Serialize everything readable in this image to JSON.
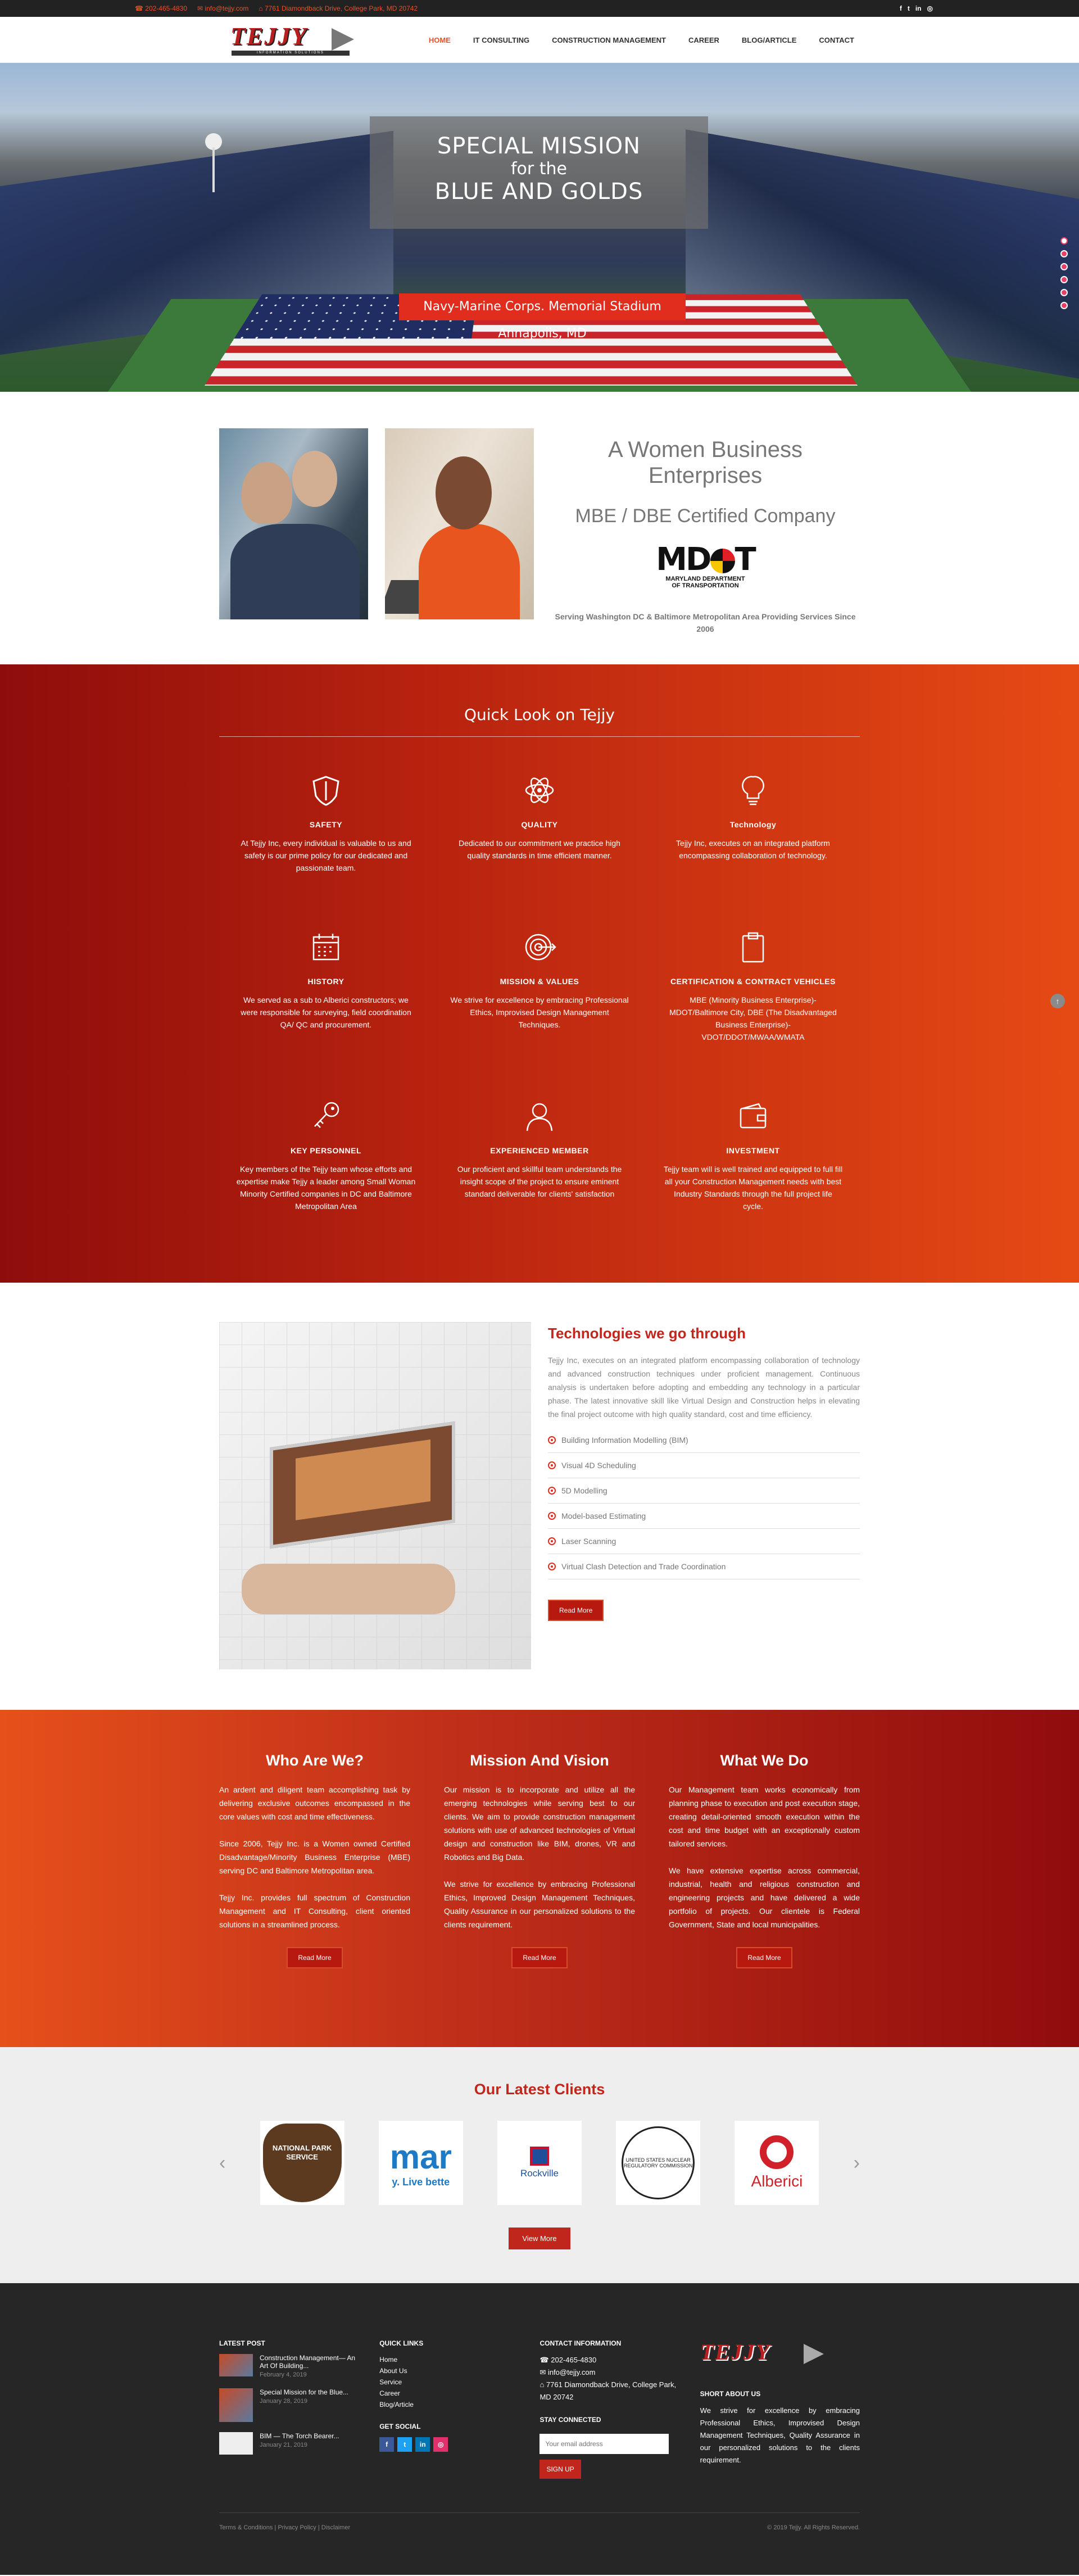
{
  "topbar": {
    "phone": "☎ 202-465-4830",
    "email": "✉ info@tejjy.com",
    "address": "⌂ 7761 Diamondback Drive, College Park, MD 20742",
    "social": [
      "f",
      "t",
      "in",
      "◎"
    ]
  },
  "logo": {
    "text": "TEJJY",
    "tagline": "INFORMATION SOLUTIONS"
  },
  "nav": [
    "HOME",
    "IT CONSULTING",
    "CONSTRUCTION MANAGEMENT",
    "CAREER",
    "BLOG/ARTICLE",
    "CONTACT"
  ],
  "hero": {
    "line1": "SPECIAL MISSION",
    "line2": "for the",
    "line3": "BLUE AND GOLDS",
    "caption": "Navy-Marine Corps. Memorial Stadium Annapolis, MD",
    "slides": 6
  },
  "wbe": {
    "title": "A Women Business Enterprises",
    "subtitle": "MBE / DBE Certified Company",
    "mdot_line1": "MARYLAND DEPARTMENT",
    "mdot_line2": "OF TRANSPORTATION",
    "serving": "Serving Washington DC & Baltimore Metropolitan Area Providing Services Since 2006"
  },
  "quick": {
    "title": "Quick Look on Tejjy",
    "items": [
      {
        "icon": "shield-icon",
        "title": "SAFETY",
        "text": "At Tejjy Inc, every individual is valuable to us and safety is our prime policy for our dedicated and passionate team."
      },
      {
        "icon": "atom-icon",
        "title": "QUALITY",
        "text": "Dedicated to our commitment we practice high quality standards in time efficient manner."
      },
      {
        "icon": "lightbulb-icon",
        "title": "Technology",
        "text": "Tejjy Inc, executes on an integrated platform encompassing collaboration of technology."
      },
      {
        "icon": "calendar-icon",
        "title": "HISTORY",
        "text": "We served as a sub to Alberici constructors; we were responsible for surveying, field coordination QA/ QC and procurement."
      },
      {
        "icon": "target-icon",
        "title": "MISSION & VALUES",
        "text": "We strive for excellence by embracing Professional Ethics, Improvised Design Management Techniques."
      },
      {
        "icon": "clipboard-icon",
        "title": "CERTIFICATION & CONTRACT VEHICLES",
        "text": "MBE (Minority Business Enterprise)- MDOT/Baltimore City, DBE (The Disadvantaged Business Enterprise)- VDOT/DDOT/MWAA/WMATA"
      },
      {
        "icon": "key-icon",
        "title": "KEY PERSONNEL",
        "text": "Key members of the Tejjy team whose efforts and expertise make Tejjy a leader among Small Woman Minority Certified companies in DC and Baltimore Metropolitan Area"
      },
      {
        "icon": "user-icon",
        "title": "EXPERIENCED MEMBER",
        "text": "Our proficient and skillful team understands the insight scope of the project to ensure eminent standard deliverable for clients' satisfaction"
      },
      {
        "icon": "wallet-icon",
        "title": "INVESTMENT",
        "text": "Tejjy team will is well trained and equipped to full fill all your Construction Management needs with best Industry Standards through the full project life cycle."
      }
    ]
  },
  "tech": {
    "title": "Technologies we go through",
    "text": "Tejjy Inc, executes on an integrated platform encompassing collaboration of technology and advanced construction techniques under proficient management. Continuous analysis is undertaken before adopting and embedding any technology in a particular phase. The latest innovative skill like Virtual Design and Construction helps in elevating the final project outcome with high quality standard, cost and time efficiency.",
    "list": [
      "Building Information Modelling (BIM)",
      "Visual 4D Scheduling",
      "5D Modelling",
      "Model-based Estimating",
      "Laser Scanning",
      "Virtual Clash Detection and Trade Coordination"
    ],
    "button": "Read More"
  },
  "who": {
    "columns": [
      {
        "title": "Who Are We?",
        "paragraphs": [
          "An ardent and diligent team accomplishing task by delivering exclusive outcomes encompassed in the core values with cost and time effectiveness.",
          "Since 2006, Tejjy Inc. is a Women owned Certified Disadvantage/Minority Business Enterprise (MBE) serving DC and Baltimore Metropolitan area.",
          "Tejjy Inc. provides full spectrum of Construction Management and IT Consulting, client oriented solutions in a streamlined process."
        ],
        "button": "Read More"
      },
      {
        "title": "Mission And Vision",
        "paragraphs": [
          "Our mission is to incorporate and utilize all the emerging technologies while serving best to our clients. We aim to provide construction management solutions with use of advanced technologies of Virtual design and construction like BIM, drones, VR and Robotics and Big Data.",
          "We strive for excellence by embracing Professional Ethics, Improved Design Management Techniques, Quality Assurance in our personalized solutions to the clients requirement."
        ],
        "button": "Read More"
      },
      {
        "title": "What We Do",
        "paragraphs": [
          "Our Management team works economically from planning phase to execution and post execution stage, creating detail-oriented smooth execution within the cost and time budget with an exceptionally custom tailored services.",
          "We have extensive expertise across commercial, industrial, health and religious construction and engineering projects and have delivered a wide portfolio of projects. Our clientele is Federal Government, State and local municipalities."
        ],
        "button": "Read More"
      }
    ]
  },
  "clients": {
    "title": "Our Latest Clients",
    "logos": {
      "nps": "NATIONAL PARK SERVICE",
      "marriott": "mar",
      "marriott_tag": "y. Live bette",
      "rockville": "Rockville",
      "nrc": "UNITED STATES NUCLEAR REGULATORY COMMISSION",
      "alberici": "Alberici"
    },
    "button": "View More"
  },
  "footer": {
    "latest_post_title": "LATEST POST",
    "posts": [
      {
        "title": "Construction Management— An Art Of Building...",
        "date": "February 4, 2019"
      },
      {
        "title": "Special Mission for the Blue...",
        "date": "January 28, 2019"
      },
      {
        "title": "BIM — The Torch Bearer...",
        "date": "January 21, 2019"
      }
    ],
    "quick_links_title": "QUICK LINKS",
    "links": [
      "Home",
      "About Us",
      "Service",
      "Career",
      "Blog/Article"
    ],
    "social_title": "GET SOCIAL",
    "social": [
      "f",
      "t",
      "in",
      "◎"
    ],
    "social_colors": [
      "#3b5998",
      "#1da1f2",
      "#0077b5",
      "#e1306c"
    ],
    "contact_title": "CONTACT INFORMATION",
    "phone": "☎ 202-465-4830",
    "email": "✉ info@tejjy.com",
    "address": "⌂ 7761 Diamondback Drive, College Park, MD 20742",
    "stay_title": "STAY CONNECTED",
    "email_placeholder": "Your email address",
    "signup": "SIGN UP",
    "about_title": "SHORT ABOUT US",
    "about": "We strive for excellence by embracing Professional Ethics, Improvised Design Management Techniques, Quality Assurance in our personalized solutions to the clients requirement.",
    "bottom_left": "Terms & Conditions | Privacy Policy | Disclaimer",
    "bottom_right": "© 2019 Tejjy. All Rights Reserved."
  }
}
